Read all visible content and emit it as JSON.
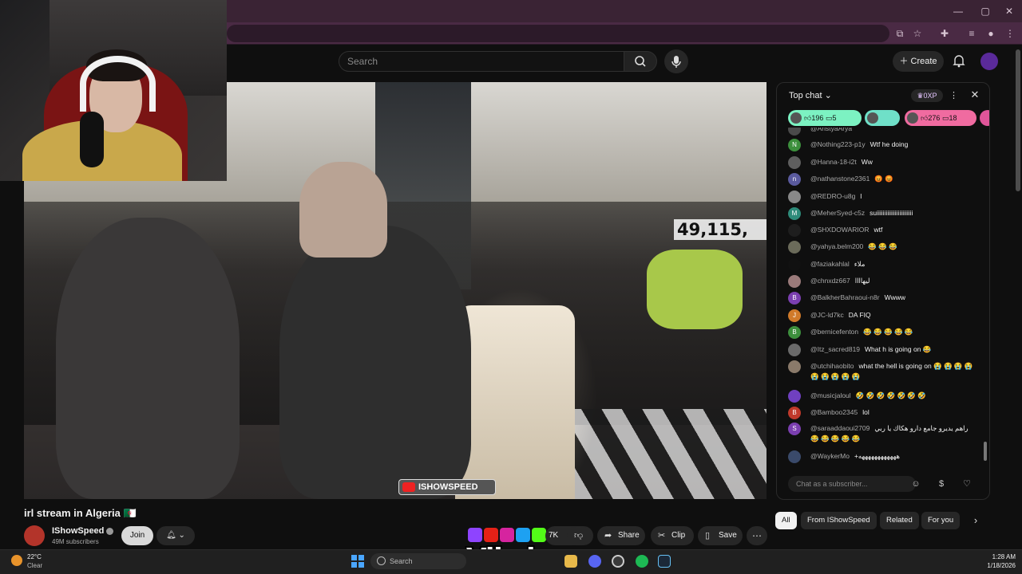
{
  "header": {
    "search_placeholder": "Search",
    "create_label": "Create"
  },
  "video": {
    "viewer_counter": "49,115,",
    "overlay_logo": "ISHOWSPEED",
    "title": "irl stream in Algeria 🇩🇿",
    "channel_name": "IShowSpeed",
    "subscribers": "49M subscribers",
    "join_label": "Join",
    "likes": "7K",
    "share_label": "Share",
    "clip_label": "Clip",
    "save_label": "Save",
    "watermark": "Vibzlo"
  },
  "chat": {
    "header_label": "Top chat",
    "xp_badge": "0XP",
    "pinned": [
      {
        "count": "196",
        "extra": "5",
        "color": "#7cf2c2"
      },
      {
        "count": "",
        "extra": "",
        "color": "#6fe0c8"
      },
      {
        "count": "276",
        "extra": "18",
        "color": "#f06ba0"
      }
    ],
    "messages": [
      {
        "author": "@AristyaArya",
        "text": "",
        "avatar": "",
        "color": "#4a4a4a"
      },
      {
        "author": "@Nothing223-p1y",
        "text": "Wtf he doing",
        "avatar": "N",
        "color": "#3c8f3c"
      },
      {
        "author": "@Hanna-18-i2t",
        "text": "Ww",
        "avatar": "",
        "color": "#5e5e5e"
      },
      {
        "author": "@nathanstone2361",
        "text": "😡 😡",
        "avatar": "n",
        "color": "#5a5a9e"
      },
      {
        "author": "@REDRO-u8g",
        "text": "l",
        "avatar": "",
        "color": "#888"
      },
      {
        "author": "@MeherSyed-c5z",
        "text": "suiiiiiiiiiiiiiiiiiiiiiiii",
        "avatar": "M",
        "color": "#2e8b7a"
      },
      {
        "author": "@SHXDOWARIOR",
        "text": "wtf",
        "avatar": "",
        "color": "#1e1e1e"
      },
      {
        "author": "@yahya.belm200",
        "text": "😂 😂 😂",
        "avatar": "",
        "color": "#6b6b5a"
      },
      {
        "author": "@faziakahlal",
        "text": "ملاء",
        "avatar": "",
        "color": "#111"
      },
      {
        "author": "@chnxdz667",
        "text": "ليهاااا",
        "avatar": "",
        "color": "#9a7a7a"
      },
      {
        "author": "@BalkherBahraoui-n8r",
        "text": "Wwww",
        "avatar": "B",
        "color": "#7b3fb0"
      },
      {
        "author": "@JC-ld7kc",
        "text": "DA FIQ",
        "avatar": "J",
        "color": "#d07a2a"
      },
      {
        "author": "@bernicefenton",
        "text": "😂 😂 😂 😂 😂",
        "avatar": "B",
        "color": "#3d8f3d"
      },
      {
        "author": "@Itz_sacred819",
        "text": "What h is going on 😂",
        "avatar": "",
        "color": "#6a6a6a"
      },
      {
        "author": "@utchihaobito",
        "text": "what the hell is going on 😭 😭 😭 😭 😭 😭 😭 😭 😭",
        "avatar": "",
        "color": "#8a7a6a"
      },
      {
        "author": "@musicjaloul",
        "text": "🤣 🤣 🤣 🤣 🤣 🤣 🤣",
        "avatar": "",
        "color": "#7040c0"
      },
      {
        "author": "@Bamboo2345",
        "text": "lol",
        "avatar": "B",
        "color": "#c0392b"
      },
      {
        "author": "@saraaddaoui2709",
        "text": "راهم يديرو جامع دارو هكاك يا ربي 😂 😂 😂 😂 😂",
        "avatar": "S",
        "color": "#7b3fb0"
      },
      {
        "author": "@WaykerMo",
        "text": "+ههههههههههههه",
        "avatar": "",
        "color": "#3a4a6a"
      }
    ],
    "input_placeholder": "Chat as a subscriber..."
  },
  "chips": [
    "All",
    "From IShowSpeed",
    "Related",
    "For you"
  ],
  "taskbar": {
    "temperature": "22°C",
    "condition": "Clear",
    "search_label": "Search",
    "time": "1:28 AM",
    "date": "1/18/2026"
  },
  "colors": {
    "browser_frame": "#3a2334",
    "page_bg": "#0f0f0f",
    "chip_active": "#f1f1f1"
  }
}
